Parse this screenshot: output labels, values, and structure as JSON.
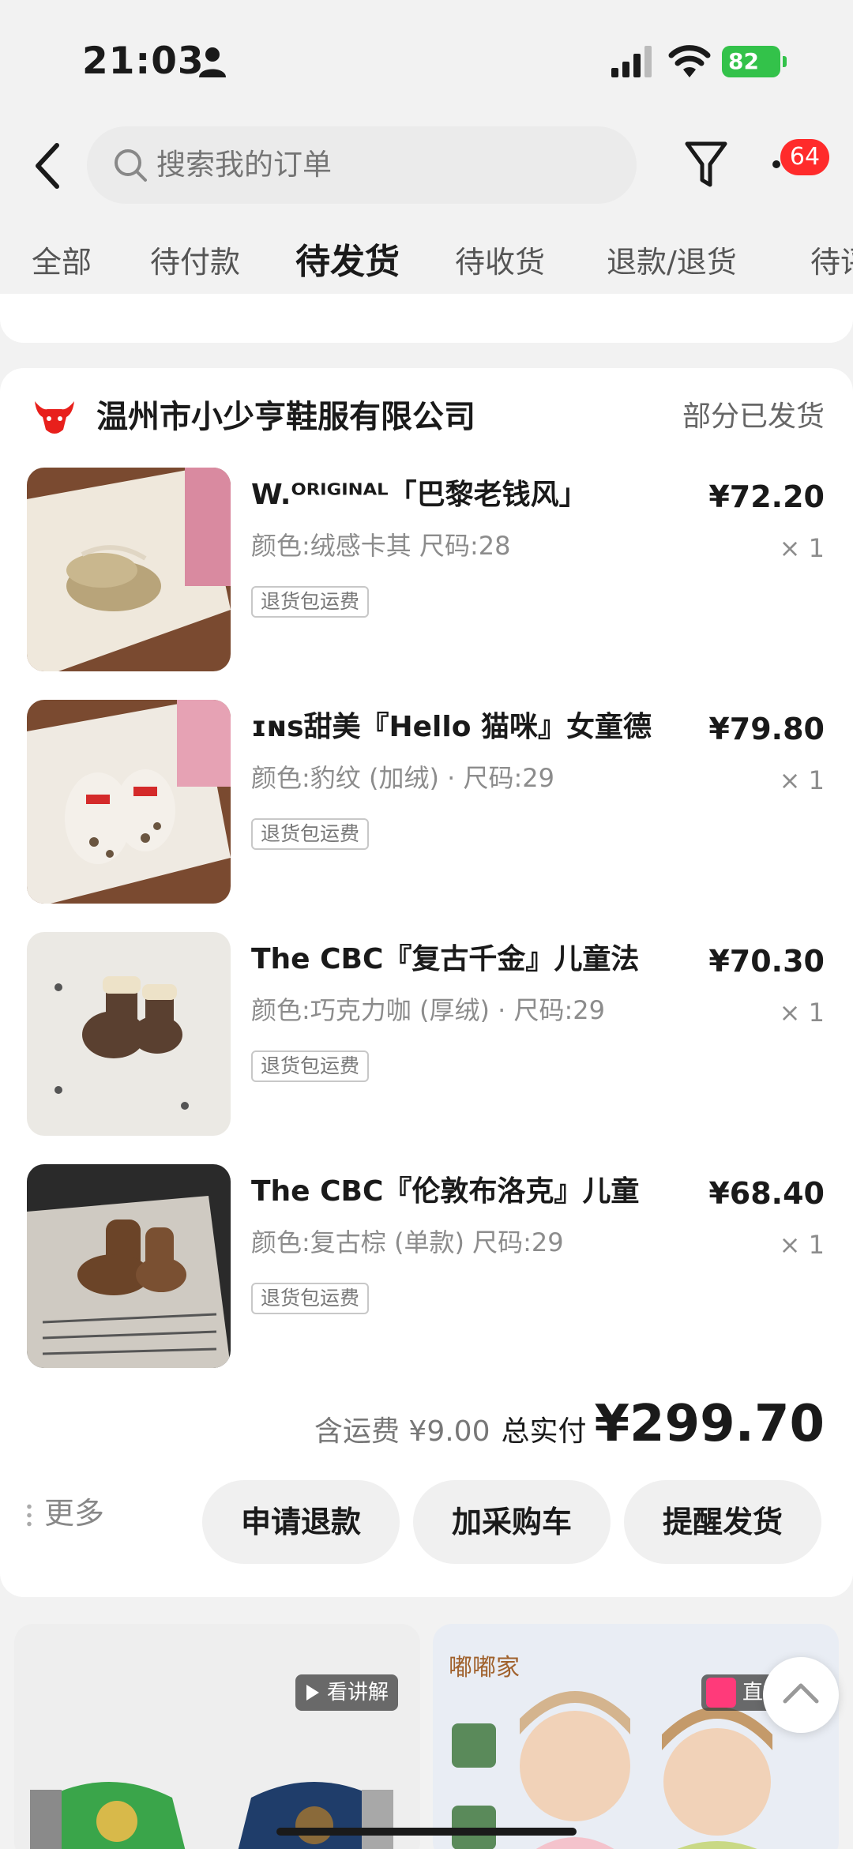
{
  "status_bar": {
    "time": "21:03",
    "battery": "82"
  },
  "header": {
    "search_placeholder": "搜索我的订单",
    "message_count": "64"
  },
  "tabs": [
    "全部",
    "待付款",
    "待发货",
    "待收货",
    "退款/退货",
    "待评价"
  ],
  "active_tab": "待发货",
  "order": {
    "shop_name": "温州市小少亨鞋服有限公司",
    "status": "部分已发货",
    "items": [
      {
        "title": "W.ᴼᴿᴵᴳᴵᴺᴬᴸ「巴黎老钱风」",
        "spec": "颜色:绒感卡其 尺码:28",
        "tag": "退货包运费",
        "price": "¥72.20",
        "qty": "× 1"
      },
      {
        "title": "ɪɴs甜美『Hello 猫咪』女童德",
        "spec": "颜色:豹纹 (加绒) · 尺码:29",
        "tag": "退货包运费",
        "price": "¥79.80",
        "qty": "× 1"
      },
      {
        "title": "The CBC『复古千金』儿童法",
        "spec": "颜色:巧克力咖 (厚绒) · 尺码:29",
        "tag": "退货包运费",
        "price": "¥70.30",
        "qty": "× 1"
      },
      {
        "title": "The CBC『伦敦布洛克』儿童",
        "spec": "颜色:复古棕 (单款) 尺码:29",
        "tag": "退货包运费",
        "price": "¥68.40",
        "qty": "× 1"
      }
    ],
    "shipping": "含运费 ¥9.00",
    "total_label": "总实付",
    "total_value": "¥299.70",
    "more_label": "更多",
    "actions": [
      "申请退款",
      "加采购车",
      "提醒发货"
    ]
  },
  "recommend": {
    "left_badge": "看讲解",
    "right_brand": "嘟嘟家",
    "right_badge": "直播中"
  },
  "colors": {
    "badge_red": "#ff2b2b",
    "battery_green": "#33c24a",
    "shop_logo_red": "#e8201c"
  },
  "icons": [
    "person-icon",
    "signal-icon",
    "wifi-icon",
    "back-icon",
    "search-icon",
    "filter-icon",
    "shop-logo",
    "chevron-up-icon"
  ]
}
